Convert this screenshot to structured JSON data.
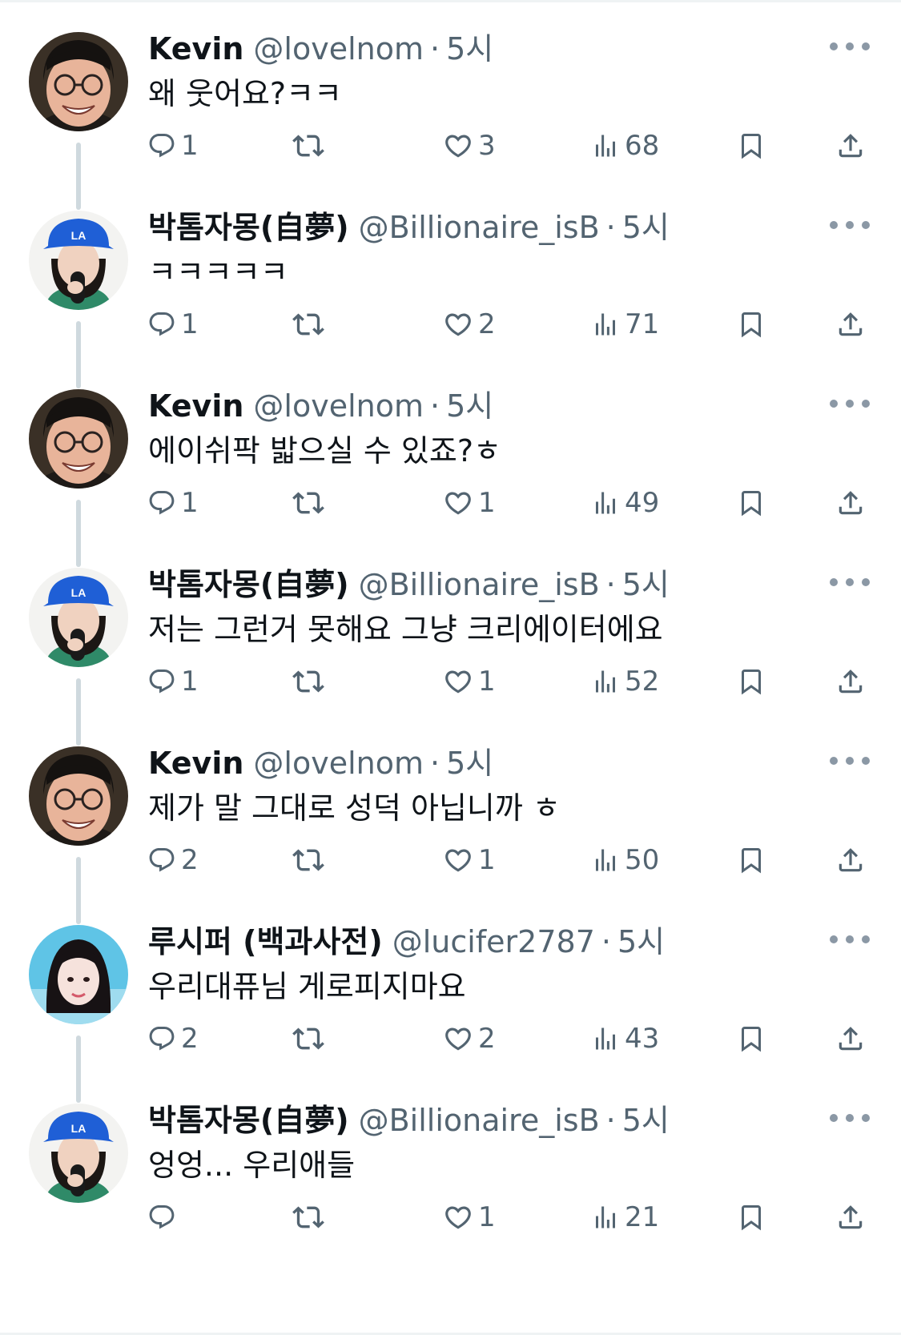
{
  "tweets": [
    {
      "name": "Kevin",
      "handle": "@lovelnom",
      "time": "5시",
      "text": "왜 웃어요?ㅋㅋ",
      "avatar": "kevin",
      "replies": "1",
      "likes": "3",
      "views": "68"
    },
    {
      "name": "박톰자몽(自夢)",
      "handle": "@Billionaire_isB",
      "time": "5시",
      "text": "ㅋㅋㅋㅋㅋ",
      "avatar": "billionaire",
      "replies": "1",
      "likes": "2",
      "views": "71"
    },
    {
      "name": "Kevin",
      "handle": "@lovelnom",
      "time": "5시",
      "text": "에이쉬팍 밟으실 수 있죠?ㅎ",
      "avatar": "kevin",
      "replies": "1",
      "likes": "1",
      "views": "49"
    },
    {
      "name": "박톰자몽(自夢)",
      "handle": "@Billionaire_isB",
      "time": "5시",
      "text": "저는 그런거 못해요 그냥 크리에이터에요",
      "avatar": "billionaire",
      "replies": "1",
      "likes": "1",
      "views": "52"
    },
    {
      "name": "Kevin",
      "handle": "@lovelnom",
      "time": "5시",
      "text": "제가 말 그대로 성덕 아닙니까 ㅎ",
      "avatar": "kevin",
      "replies": "2",
      "likes": "1",
      "views": "50"
    },
    {
      "name": "루시퍼 (백과사전)",
      "handle": "@lucifer2787",
      "time": "5시",
      "text": "우리대퓨님 게로피지마요",
      "avatar": "lucifer",
      "replies": "2",
      "likes": "2",
      "views": "43"
    },
    {
      "name": "박톰자몽(自夢)",
      "handle": "@Billionaire_isB",
      "time": "5시",
      "text": "엉엉... 우리애들",
      "avatar": "billionaire",
      "replies": "",
      "likes": "1",
      "views": "21"
    }
  ],
  "icons": {
    "reply": "reply-icon",
    "retweet": "retweet-icon",
    "like": "heart-icon",
    "views": "views-icon",
    "bookmark": "bookmark-icon",
    "share": "share-icon",
    "more": "more-icon"
  },
  "colors": {
    "text": "#0f1419",
    "secondary": "#536471",
    "thread_line": "#cfd9de"
  }
}
